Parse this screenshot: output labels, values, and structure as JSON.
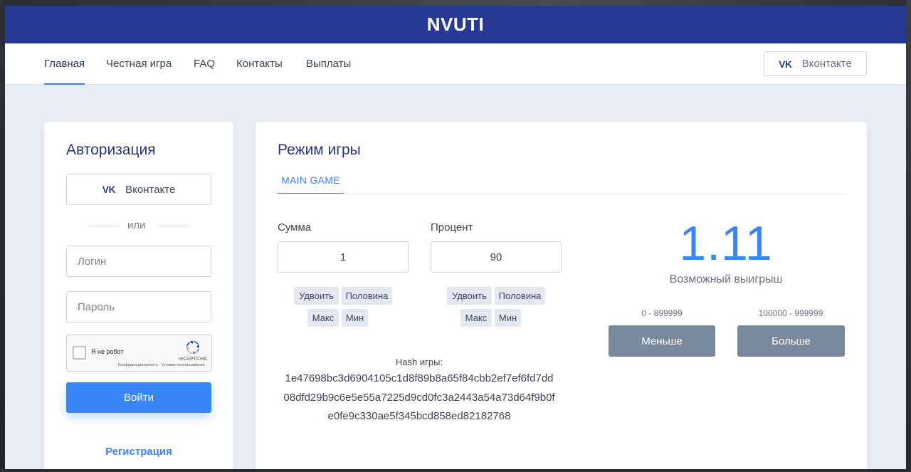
{
  "brand": "NVUTI",
  "nav": {
    "items": [
      {
        "label": "Главная",
        "active": true
      },
      {
        "label": "Честная игра"
      },
      {
        "label": "FAQ"
      },
      {
        "label": "Контакты"
      },
      {
        "label": "Выплаты"
      }
    ],
    "vk_button": {
      "icon": "vk-logo-icon",
      "logo_text": "VK",
      "label": "Вконтакте"
    }
  },
  "auth": {
    "title": "Авторизация",
    "vk_button": {
      "icon": "vk-logo-icon",
      "logo_text": "VK",
      "label": "Вконтакте"
    },
    "or_text": "или",
    "login_placeholder": "Логин",
    "password_placeholder": "Пароль",
    "captcha": {
      "label": "Я не робот",
      "brand": "reCAPTCHA",
      "terms": "Конфиденциальность - Условия использования"
    },
    "submit_label": "Войти",
    "register_label": "Регистрация"
  },
  "game": {
    "title": "Режим игры",
    "tab_label": "MAIN GAME",
    "amount": {
      "label": "Сумма",
      "value": "1",
      "chips": [
        "Удвоить",
        "Половина",
        "Макс",
        "Мин"
      ]
    },
    "percent": {
      "label": "Процент",
      "value": "90",
      "chips": [
        "Удвоить",
        "Половина",
        "Макс",
        "Мин"
      ]
    },
    "hash": {
      "label": "Hash игры:",
      "lines": [
        "1e47698bc3d6904105c1d8f89b8a65f84cbb2ef7ef6fd7dd",
        "08dfd29b9c6e5e55a7225d9cd0fc3a2443a54a73d64f9b0f",
        "e0fe9c330ae5f345bcd858ed82182768"
      ]
    },
    "payout": "1.11",
    "payout_label": "Возможный выигрыш",
    "less": {
      "range": "0 - 899999",
      "label": "Меньше"
    },
    "more": {
      "range": "100000 - 999999",
      "label": "Больше"
    }
  },
  "colors": {
    "brand_bar": "#263a94",
    "accent": "#3b86f7",
    "bet_button": "#79899d",
    "background": "#e9edf6"
  }
}
